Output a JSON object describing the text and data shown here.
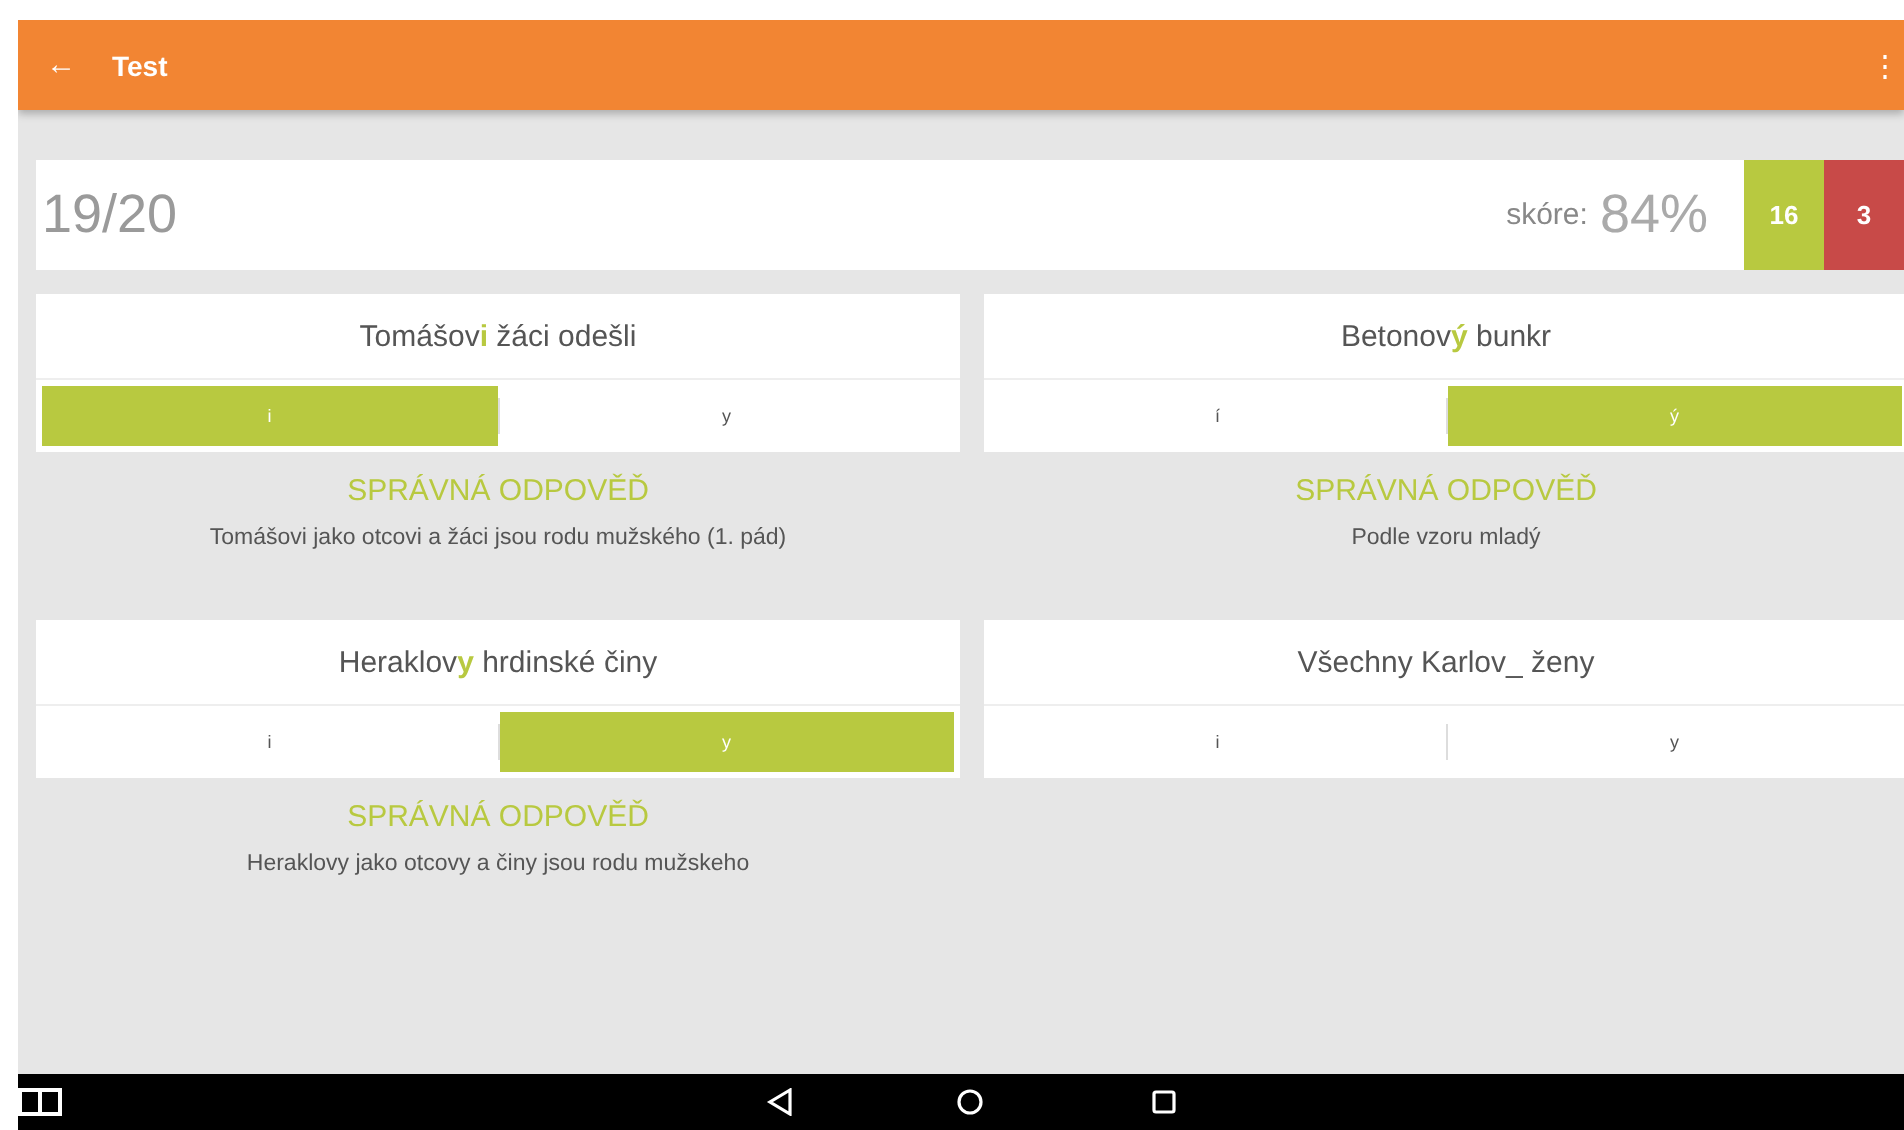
{
  "app_bar": {
    "back": "←",
    "title": "Test",
    "menu": "⋮"
  },
  "score": {
    "progress": "19/20",
    "label": "skóre:",
    "percent": "84%",
    "correct": "16",
    "wrong": "3"
  },
  "questions": [
    {
      "text": "Tomášov**i** žáci odešli",
      "options": [
        {
          "label": "i",
          "selected": true
        },
        {
          "label": "y",
          "selected": false
        }
      ],
      "feedback": {
        "title": "SPRÁVNÁ ODPOVĚĎ",
        "explanation": "Tomášovi jako otcovi a žáci jsou rodu mužského (1. pád)"
      }
    },
    {
      "text": "Betonov**ý** bunkr",
      "options": [
        {
          "label": "í",
          "selected": false
        },
        {
          "label": "ý",
          "selected": true
        }
      ],
      "feedback": {
        "title": "SPRÁVNÁ ODPOVĚĎ",
        "explanation": "Podle vzoru mladý"
      }
    },
    {
      "text": "Heraklov**y** hrdinské činy",
      "options": [
        {
          "label": "i",
          "selected": false
        },
        {
          "label": "y",
          "selected": true
        }
      ],
      "feedback": {
        "title": "SPRÁVNÁ ODPOVĚĎ",
        "explanation": "Heraklovy jako otcovy a činy jsou rodu mužskeho"
      }
    },
    {
      "text": "Všechny Karlov_ ženy",
      "options": [
        {
          "label": "i",
          "selected": false
        },
        {
          "label": "y",
          "selected": false
        }
      ]
    }
  ]
}
